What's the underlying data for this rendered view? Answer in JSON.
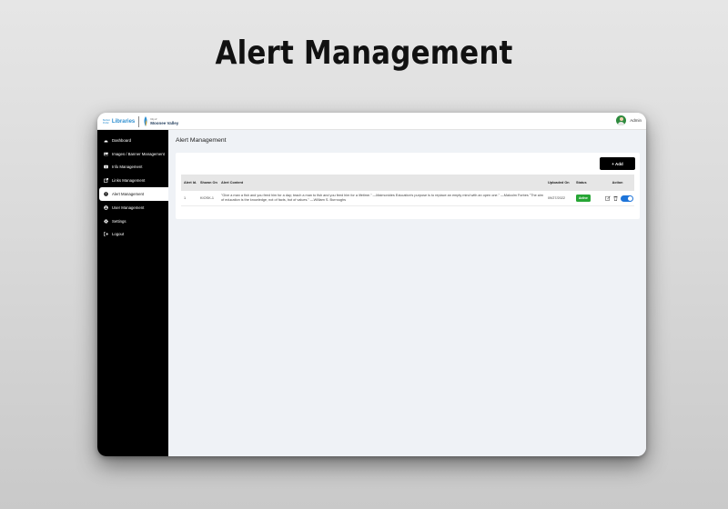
{
  "hero": {
    "title": "Alert Management"
  },
  "brand": {
    "libraries_small_1": "Bartlett",
    "libraries_small_2": "Public",
    "libraries_word": "Libraries",
    "city_small": "City of",
    "city_name": "Moonee Valley"
  },
  "user": {
    "name": "Admin"
  },
  "sidebar": {
    "items": [
      {
        "label": "Dashboard",
        "icon": "dashboard-icon"
      },
      {
        "label": "Images / Banner Management",
        "icon": "image-icon"
      },
      {
        "label": "Info Management",
        "icon": "info-icon"
      },
      {
        "label": "Links Management",
        "icon": "link-icon"
      },
      {
        "label": "Alert Management",
        "icon": "alert-icon",
        "active": true
      },
      {
        "label": "User Management",
        "icon": "user-icon"
      },
      {
        "label": "Settings",
        "icon": "gear-icon"
      },
      {
        "label": "Logout",
        "icon": "logout-icon"
      }
    ]
  },
  "main": {
    "title": "Alert Management",
    "add_label": "+ Add",
    "table": {
      "headers": {
        "id": "Alert Id.",
        "shown_on": "Shown On",
        "content": "Alert Content",
        "uploaded_on": "Uploaded On",
        "status": "Status",
        "action": "Action"
      },
      "rows": [
        {
          "id": "1",
          "shown_on": "KIOSK-1",
          "content": "\"Give a man a fish and you feed him for a day; teach a man to fish and you feed him for a lifetime.\" —Maimonides Education's purpose is to replace an empty mind with an open one.\" —Malcolm Forbes \"The aim of education is the knowledge, not of facts, but of values.\" —William S. Burroughs",
          "uploaded_on": "09/27/2022",
          "status": "Active"
        }
      ]
    }
  },
  "colors": {
    "sidebar_bg": "#000000",
    "main_bg": "#eff2f6",
    "badge_active": "#27a635",
    "toggle_on": "#1e74d9",
    "brand_blue": "#2f8fd0"
  }
}
